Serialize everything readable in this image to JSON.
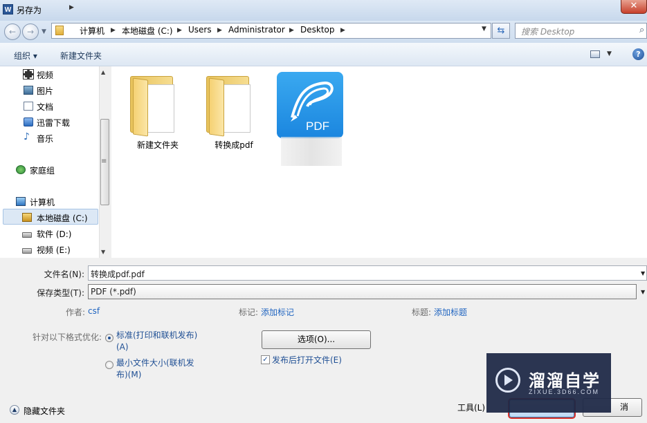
{
  "window": {
    "title": "另存为",
    "app_icon_letter": "W",
    "close_glyph": "✕"
  },
  "nav": {
    "back_glyph": "←",
    "forward_glyph": "→",
    "breadcrumbs": [
      "计算机",
      "本地磁盘 (C:)",
      "Users",
      "Administrator",
      "Desktop"
    ],
    "search_placeholder": "搜索 Desktop"
  },
  "toolbar": {
    "organize": "组织 ▾",
    "new_folder": "新建文件夹"
  },
  "sidebar": {
    "items": [
      {
        "label": "视频",
        "icon": "video-icon"
      },
      {
        "label": "图片",
        "icon": "picture-icon"
      },
      {
        "label": "文档",
        "icon": "document-icon"
      },
      {
        "label": "迅雷下载",
        "icon": "thunder-icon"
      },
      {
        "label": "音乐",
        "icon": "music-icon"
      },
      {
        "label": "家庭组",
        "icon": "homegroup-icon"
      },
      {
        "label": "计算机",
        "icon": "computer-icon"
      },
      {
        "label": "本地磁盘 (C:)",
        "icon": "system-disk-icon"
      },
      {
        "label": "软件 (D:)",
        "icon": "disk-icon"
      },
      {
        "label": "视频 (E:)",
        "icon": "disk-icon"
      }
    ],
    "selected_index": 7
  },
  "files": [
    {
      "name": "新建文件夹",
      "type": "folder"
    },
    {
      "name": "转换成pdf",
      "type": "folder"
    },
    {
      "name": "",
      "type": "pdf-app",
      "badge": "PDF"
    }
  ],
  "form": {
    "filename_label": "文件名(N):",
    "filename_value": "转换成pdf.pdf",
    "filetype_label": "保存类型(T):",
    "filetype_value": "PDF (*.pdf)",
    "author_label": "作者:",
    "author_value": "csf",
    "tags_label": "标记:",
    "tags_value": "添加标记",
    "title_label": "标题:",
    "title_value": "添加标题",
    "optimize_label": "针对以下格式优化:",
    "option_standard_line1": "标准(打印和联机发布)",
    "option_standard_line2": "(A)",
    "option_min_line1": "最小文件大小(联机发",
    "option_min_line2": "布)(M)",
    "options_button": "选项(O)...",
    "open_after_publish": "发布后打开文件(E)"
  },
  "footer": {
    "hide_folders": "隐藏文件夹",
    "tools": "工具(L)",
    "save": "",
    "cancel": "消"
  },
  "watermark": {
    "title": "溜溜自学",
    "subtitle": "ZIXUE.3D66.COM"
  }
}
